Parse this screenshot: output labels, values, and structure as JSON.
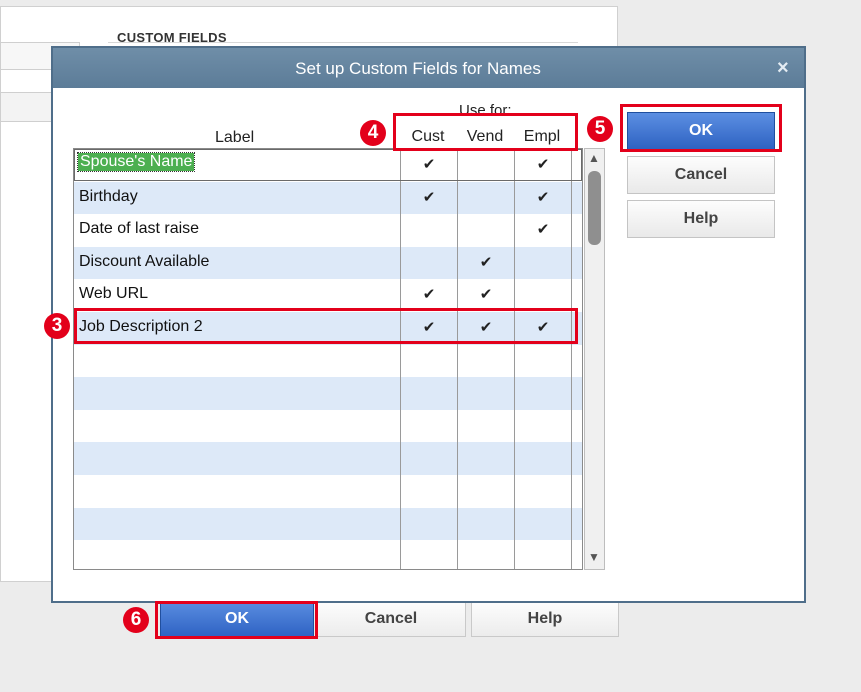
{
  "background": {
    "section_title": "CUSTOM FIELDS",
    "buttons": {
      "ok": "OK",
      "cancel": "Cancel",
      "help": "Help"
    }
  },
  "dialog": {
    "title": "Set up Custom Fields for Names",
    "close_glyph": "×",
    "use_for": "Use for:",
    "headers": {
      "label": "Label",
      "cust": "Cust",
      "vend": "Vend",
      "empl": "Empl"
    },
    "rows": [
      {
        "label": "Spouse's Name",
        "cust": true,
        "vend": false,
        "empl": true,
        "selected": true
      },
      {
        "label": "Birthday",
        "cust": true,
        "vend": false,
        "empl": true
      },
      {
        "label": "Date of last raise",
        "cust": false,
        "vend": false,
        "empl": true
      },
      {
        "label": "Discount Available",
        "cust": false,
        "vend": true,
        "empl": false
      },
      {
        "label": "Web URL",
        "cust": true,
        "vend": true,
        "empl": false
      },
      {
        "label": "Job Description 2",
        "cust": true,
        "vend": true,
        "empl": true
      },
      {
        "label": ""
      },
      {
        "label": ""
      },
      {
        "label": ""
      },
      {
        "label": ""
      },
      {
        "label": ""
      },
      {
        "label": ""
      },
      {
        "label": ""
      }
    ],
    "check_glyph": "✔",
    "scroll_up_glyph": "▲",
    "scroll_down_glyph": "▼",
    "buttons": {
      "ok": "OK",
      "cancel": "Cancel",
      "help": "Help"
    }
  },
  "annotations": {
    "three": "3",
    "four": "4",
    "five": "5",
    "six": "6"
  },
  "colors": {
    "highlight": "#e3001b",
    "titlebar": "#5c7c98",
    "ok_button": "#2e62c2",
    "row_alt": "#dde9f8",
    "selected_label": "#4caf50"
  }
}
